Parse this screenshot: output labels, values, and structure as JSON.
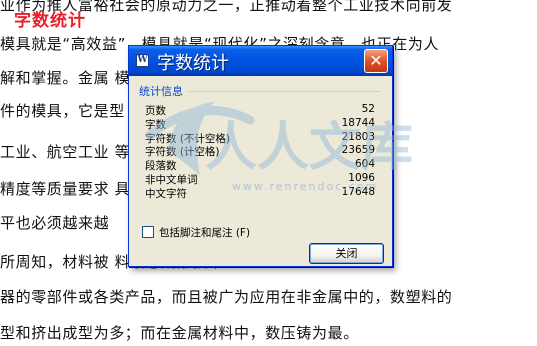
{
  "document": {
    "heading": "字数统计",
    "lines": [
      "业作为推人富裕社会的原动力之一，正推动着整个工业技术向前发",
      "模具就是“高效益”，模具就是“现代化”之深刻含意，也正在为人",
      "解和掌握。金属                                              模，是用于成型金属",
      "件的模具，它是型                                            工业，尤其是汽车、",
      "工业、航空工业                                                 等铸件的需求量越来",
      "精度等质量要求                                              具的开发、设计与制",
      "平也必须越来越",
      "所周知，材料被                                              料液态成形技术",
      "器的零部件或各类产品，而且被广为应用在非金属中的，数塑料的",
      "型和挤出成型为多；而在金属材料中，数压铸为最。"
    ]
  },
  "dialog": {
    "title": "字数统计",
    "icon_letter": "W",
    "close_glyph": "✕",
    "group_label": "统计信息",
    "stats": [
      {
        "label": "页数",
        "value": "52"
      },
      {
        "label": "字数",
        "value": "18744"
      },
      {
        "label": "字符数 (不计空格)",
        "value": "21803"
      },
      {
        "label": "字符数 (计空格)",
        "value": "23659"
      },
      {
        "label": "段落数",
        "value": "604"
      },
      {
        "label": "非中文单词",
        "value": "1096"
      },
      {
        "label": "中文字符",
        "value": "17648"
      }
    ],
    "checkbox_label": "包括脚注和尾注 (F)",
    "checkbox_checked": false,
    "close_button": "关闭"
  },
  "watermark": {
    "text_cn": "人人文库",
    "text_url": "www.renrendoc.com"
  },
  "colors": {
    "heading": "#e8202a",
    "titlebar": "#0053e1",
    "dialog_bg": "#ece9d8",
    "group_label": "#0046d5",
    "watermark": "#8fb6d8"
  }
}
